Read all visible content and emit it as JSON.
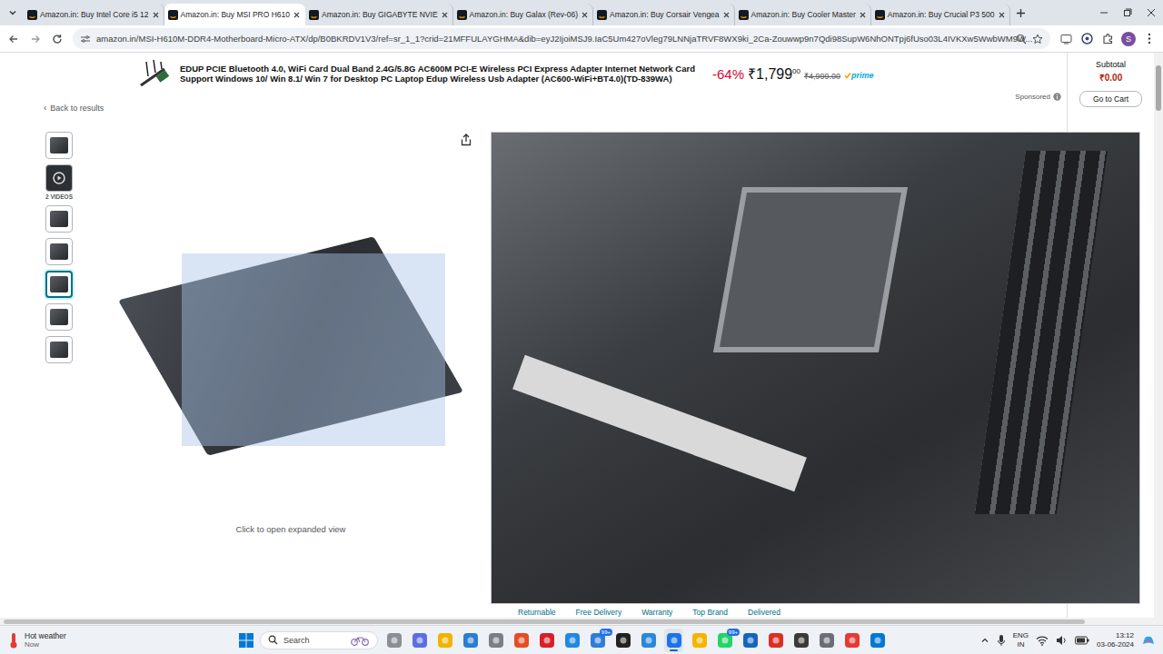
{
  "browser": {
    "tabs": [
      {
        "label": "Amazon.in: Buy Intel Core i5 12",
        "selected": false
      },
      {
        "label": "Amazon.in: Buy MSI PRO H610",
        "selected": true
      },
      {
        "label": "Amazon.in: Buy GIGABYTE NVIE",
        "selected": false
      },
      {
        "label": "Amazon.in: Buy Galax (Rev-06)",
        "selected": false
      },
      {
        "label": "Amazon.in: Buy Corsair Vengea",
        "selected": false
      },
      {
        "label": "Amazon.in: Buy Cooler Master",
        "selected": false
      },
      {
        "label": "Amazon.in: Buy Crucial P3 500",
        "selected": false
      }
    ],
    "address": "amazon.in/MSI-H610M-DDR4-Motherboard-Micro-ATX/dp/B0BKRDV1V3/ref=sr_1_1?crid=21MFFULAYGHMA&dib=eyJ2IjoiMSJ9.IaC5Um427oVleg79LNNjaTRVF8WX9ki_2Ca-Zouwwp9n7Qdi98SupW6NhONTpj6fUso03L4IVKXw5WwbWM9W...",
    "profile_initial": "S"
  },
  "sponsored_banner": {
    "title": "EDUP PCIE Bluetooth 4.0, WiFi Card Dual Band 2.4G/5.8G AC600M PCI-E Wireless PCI Express Adapter Internet Network Card Support Windows 10/ Win 8.1/ Win 7 for Desktop PC Laptop Edup Wireless Usb Adapter (AC600-WiFi+BT4.0)(TD-839WA)",
    "discount": "-64%",
    "price": "₹1,799",
    "price_fraction": "00",
    "list_price": "₹4,999.00",
    "badge": "prime",
    "sponsored_label": "Sponsored"
  },
  "cart": {
    "label": "Subtotal",
    "amount": "₹0.00",
    "button": "Go to Cart"
  },
  "back_link": {
    "icon": "‹",
    "label": "Back to results"
  },
  "gallery": {
    "thumbnails": [
      {
        "kind": "image",
        "selected": false
      },
      {
        "kind": "video",
        "selected": false
      },
      {
        "kind": "image",
        "selected": false
      },
      {
        "kind": "image",
        "selected": false
      },
      {
        "kind": "image",
        "selected": true
      },
      {
        "kind": "image",
        "selected": false
      },
      {
        "kind": "image",
        "selected": false
      }
    ],
    "videos_label": "2 VIDEOS",
    "hint": "Click to open expanded view"
  },
  "features": [
    "Returnable",
    "Free Delivery",
    "Warranty",
    "Top Brand",
    "Delivered"
  ],
  "taskbar": {
    "weather": {
      "title": "Hot weather",
      "subtitle": "Now"
    },
    "search_placeholder": "Search",
    "apps": [
      {
        "active": false
      },
      {
        "active": false
      },
      {
        "active": false
      },
      {
        "active": false
      },
      {
        "active": false
      },
      {
        "active": false
      },
      {
        "active": false
      },
      {
        "active": false
      },
      {
        "active": false,
        "badge": "99+"
      },
      {
        "active": false
      },
      {
        "active": false
      },
      {
        "active": true
      },
      {
        "active": false
      },
      {
        "active": false,
        "badge": "99+"
      },
      {
        "active": false
      },
      {
        "active": false
      },
      {
        "active": false
      },
      {
        "active": false
      },
      {
        "active": false
      },
      {
        "active": false
      }
    ],
    "tray": {
      "language": "ENG",
      "region": "IN",
      "time": "13:12",
      "date": "03-06-2024"
    }
  }
}
